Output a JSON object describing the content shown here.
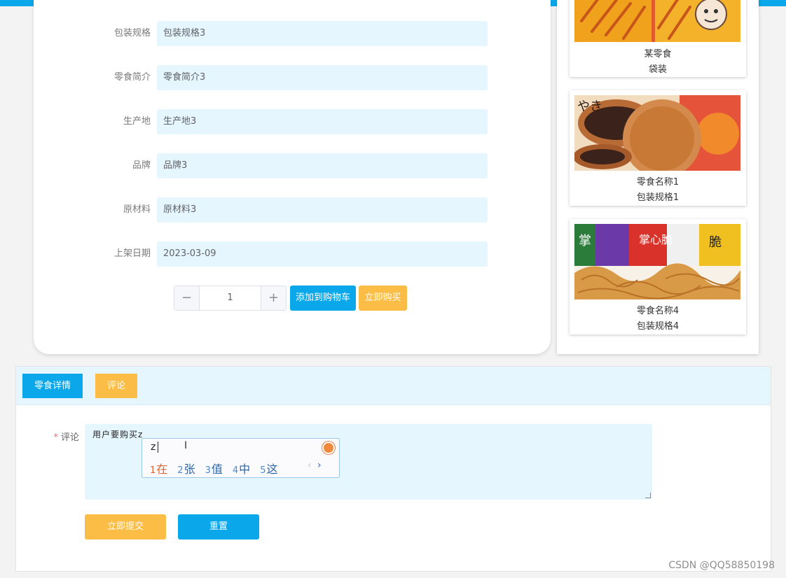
{
  "detail": {
    "fields": [
      {
        "label": "包装规格",
        "value": "包装规格3"
      },
      {
        "label": "零食简介",
        "value": "零食简介3"
      },
      {
        "label": "生产地",
        "value": "生产地3"
      },
      {
        "label": "品牌",
        "value": "品牌3"
      },
      {
        "label": "原材料",
        "value": "原材料3"
      },
      {
        "label": "上架日期",
        "value": "2023-03-09"
      }
    ],
    "quantity": "1",
    "minus_symbol": "−",
    "plus_symbol": "+",
    "add_to_cart_label": "添加到购物车",
    "buy_now_label": "立即购买"
  },
  "recommendations": [
    {
      "name": "某零食",
      "spec": "袋装"
    },
    {
      "name": "零食名称1",
      "spec": "包装规格1"
    },
    {
      "name": "零食名称4",
      "spec": "包装规格4"
    }
  ],
  "tabs": {
    "detail_label": "零食详情",
    "comment_label": "评论"
  },
  "comment_form": {
    "required_mark": "*",
    "label": "评论",
    "text": "用户要购买z",
    "submit_label": "立即提交",
    "reset_label": "重置"
  },
  "ime": {
    "input": "z",
    "candidates": [
      {
        "n": "1",
        "char": "在"
      },
      {
        "n": "2",
        "char": "张"
      },
      {
        "n": "3",
        "char": "值"
      },
      {
        "n": "4",
        "char": "中"
      },
      {
        "n": "5",
        "char": "这"
      }
    ],
    "prev": "‹",
    "next": "›",
    "cursor_glyph": "I"
  },
  "watermark": "CSDN @QQ58850198",
  "colors": {
    "primary": "#0aa8ea",
    "accent": "#fbbd45",
    "field_bg": "#e6f6fe"
  }
}
